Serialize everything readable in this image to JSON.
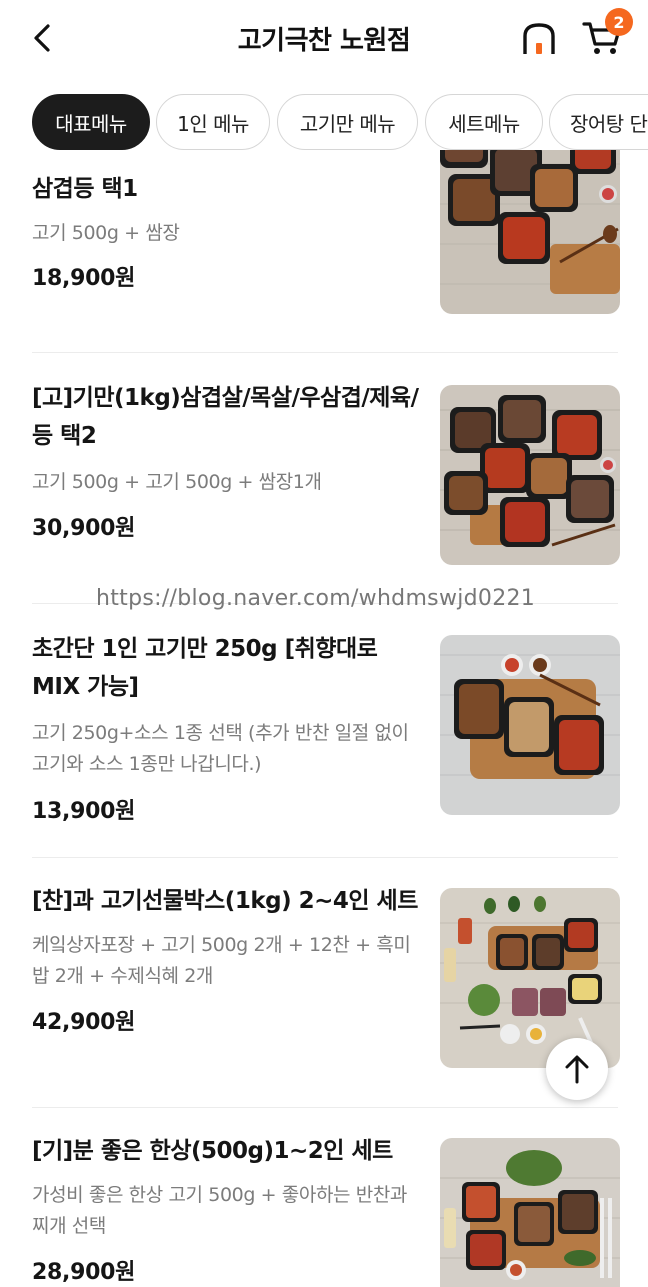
{
  "header": {
    "title": "고기극찬 노원점",
    "cart_count": "2",
    "accent_color": "#f5681f"
  },
  "tabs": [
    {
      "label": "대표메뉴",
      "active": true
    },
    {
      "label": "1인 메뉴",
      "active": false
    },
    {
      "label": "고기만 메뉴",
      "active": false
    },
    {
      "label": "세트메뉴",
      "active": false
    },
    {
      "label": "장어탕 단",
      "active": false
    }
  ],
  "menu_items": [
    {
      "name": "삼겹등 택1",
      "desc": "고기 500g + 쌈장",
      "price": "18,900원"
    },
    {
      "name": "[고]기만(1kg)삼겹살/목살/우삼겹/제육/등 택2",
      "desc": "고기 500g + 고기 500g + 쌈장1개",
      "price": "30,900원"
    },
    {
      "name": "초간단 1인 고기만 250g [취향대로 MIX 가능]",
      "desc": "고기 250g+소스 1종 선택 (추가 반찬 일절 없이 고기와 소스 1종만 나갑니다.)",
      "price": "13,900원"
    },
    {
      "name": "[찬]과 고기선물박스(1kg) 2~4인 세트",
      "desc": "케잌상자포장 + 고기 500g 2개 + 12찬 + 흑미밥 2개 + 수제식혜 2개",
      "price": "42,900원"
    },
    {
      "name": "[기]분 좋은 한상(500g)1~2인 세트",
      "desc": "가성비 좋은 한상 고기 500g + 좋아하는 반찬과 찌개 선택",
      "price": "28,900원"
    }
  ],
  "watermark": "https://blog.naver.com/whdmswjd0221",
  "icons": {
    "back": "chevron-left-icon",
    "home": "home-icon",
    "cart": "cart-icon",
    "scroll_top": "arrow-up-icon"
  }
}
